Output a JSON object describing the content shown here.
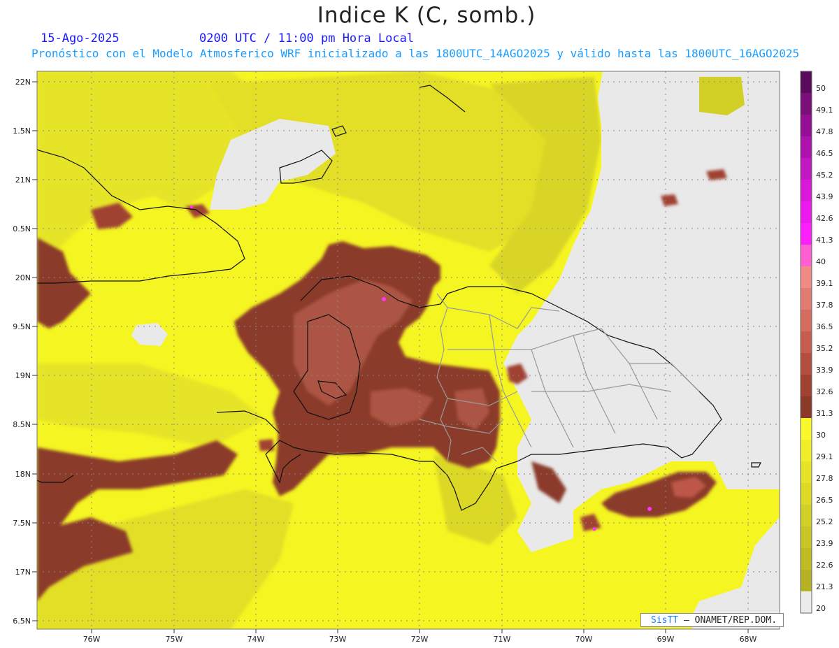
{
  "header": {
    "title": "Indice K (C, somb.)",
    "date": "15-Ago-2025",
    "time": "0200 UTC / 11:00 pm Hora Local",
    "subtitle": "Pronóstico con el Modelo Atmosferico WRF inicializado a las 1800UTC_14AGO2025 y válido hasta las  1800UTC_16AGO2025"
  },
  "map": {
    "lat_labels": [
      "22N",
      "1.5N",
      "21N",
      "0.5N",
      "20N",
      "9.5N",
      "19N",
      "8.5N",
      "18N",
      "7.5N",
      "17N",
      "6.5N"
    ],
    "lon_labels": [
      "76W",
      "75W",
      "74W",
      "73W",
      "72W",
      "71W",
      "70W",
      "69W",
      "68W"
    ],
    "colors": {
      "no_data": "#e9e9e9",
      "yellow_bright": "#f5f522",
      "yellow_mid": "#e4e228",
      "yellow_dark": "#cfcb2a",
      "brown": "#8b3a2a",
      "brown_light": "#b45a4a",
      "magenta": "#ff33ff",
      "coast": "#111111",
      "border": "#aaaaaa"
    }
  },
  "colorbar": {
    "labels": [
      "50",
      "49.1",
      "47.8",
      "46.5",
      "45.2",
      "43.9",
      "42.6",
      "41.3",
      "40",
      "39.1",
      "37.8",
      "36.5",
      "35.2",
      "33.9",
      "32.6",
      "31.3",
      "30",
      "29.1",
      "27.8",
      "26.5",
      "25.2",
      "23.9",
      "22.6",
      "21.3",
      "20"
    ],
    "colors": [
      "#5a0a5a",
      "#7a0f7a",
      "#940f94",
      "#ad12ad",
      "#c316c3",
      "#d918d9",
      "#ec1aec",
      "#fb20fb",
      "#ff5fd0",
      "#f08a84",
      "#e27b72",
      "#d46c60",
      "#c65d50",
      "#b34e40",
      "#a04232",
      "#8b3a2a",
      "#f8f82a",
      "#f0ee29",
      "#e6e428",
      "#dcd927",
      "#d2cf27",
      "#c9c526",
      "#c0bb25",
      "#b7b124",
      "#ececec"
    ]
  },
  "credit": {
    "brand": "SisTT",
    "text": "– ONAMET/REP.DOM."
  }
}
